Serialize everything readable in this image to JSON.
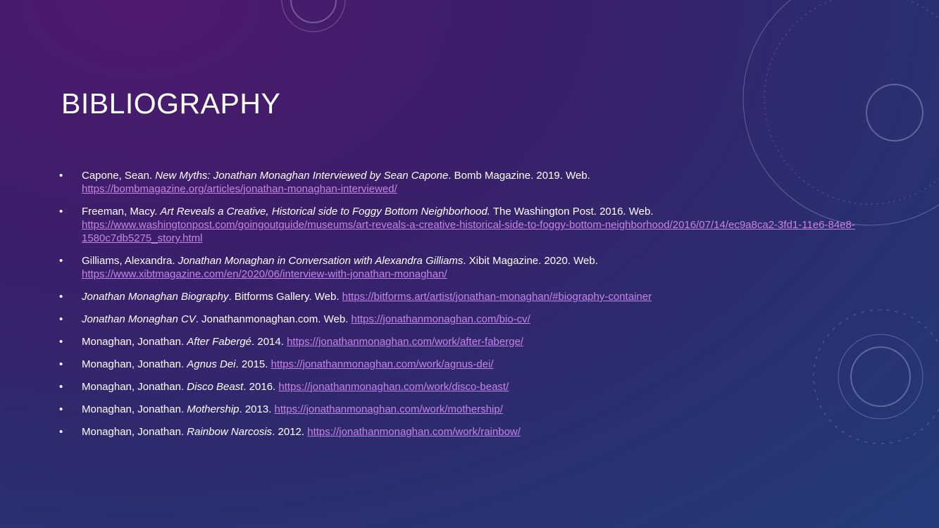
{
  "slide": {
    "title": "BIBLIOGRAPHY",
    "bullet": "•",
    "colors": {
      "link": "#c584e6",
      "text": "#ffffff",
      "background_top": "#4f1a6e",
      "background_bottom": "#243a78"
    },
    "entries": [
      {
        "author": "Capone, Sean. ",
        "title": "New Myths: Jonathan Monaghan Interviewed by Sean Capone",
        "rest": ". Bomb Magazine. 2019. Web.",
        "url": "https://bombmagazine.org/articles/jonathan-monaghan-interviewed/"
      },
      {
        "author": "Freeman, Macy. ",
        "title": "Art Reveals a Creative, Historical side to Foggy Bottom Neighborhood.",
        "rest": " The Washington Post. 2016. Web.",
        "url": "https://www.washingtonpost.com/goingoutguide/museums/art-reveals-a-creative-historical-side-to-foggy-bottom-neighborhood/2016/07/14/ec9a8ca2-3fd1-11e6-84e8-1580c7db5275_story.html"
      },
      {
        "author": "Gilliams, Alexandra. ",
        "title": "Jonathan Monaghan in Conversation with Alexandra Gilliams",
        "rest": ". Xibit Magazine. 2020. Web.",
        "url": "https://www.xibtmagazine.com/en/2020/06/interview-with-jonathan-monaghan/"
      },
      {
        "author": "",
        "title": "Jonathan Monaghan Biography",
        "rest": ". Bitforms Gallery. Web. ",
        "url": "https://bitforms.art/artist/jonathan-monaghan/#biography-container"
      },
      {
        "author": "",
        "title": "Jonathan Monaghan CV",
        "rest": ". Jonathanmonaghan.com. Web. ",
        "url": "https://jonathanmonaghan.com/bio-cv/"
      },
      {
        "author": "Monaghan, Jonathan. ",
        "title": "After Fabergé",
        "rest": ". 2014. ",
        "url": "https://jonathanmonaghan.com/work/after-faberge/"
      },
      {
        "author": "Monaghan, Jonathan. ",
        "title": "Agnus Dei",
        "rest": ". 2015. ",
        "url": "https://jonathanmonaghan.com/work/agnus-dei/"
      },
      {
        "author": "Monaghan, Jonathan. ",
        "title": "Disco Beast",
        "rest": ". 2016. ",
        "url": "https://jonathanmonaghan.com/work/disco-beast/"
      },
      {
        "author": "Monaghan, Jonathan. ",
        "title": "Mothership",
        "rest": ". 2013. ",
        "url": "https://jonathanmonaghan.com/work/mothership/"
      },
      {
        "author": "Monaghan, Jonathan. ",
        "title": "Rainbow Narcosis",
        "rest": ". 2012. ",
        "url": "https://jonathanmonaghan.com/work/rainbow/"
      }
    ]
  }
}
